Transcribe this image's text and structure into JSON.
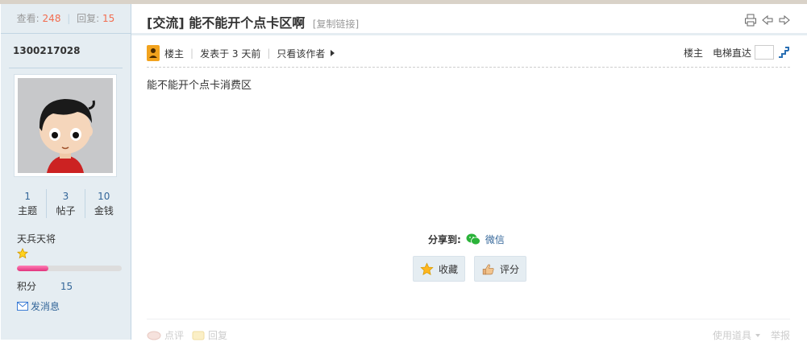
{
  "sidebar": {
    "stats": {
      "views_label": "查看:",
      "views": "248",
      "replies_label": "回复:",
      "replies": "15"
    },
    "username": "1300217028",
    "counts": [
      {
        "value": "1",
        "label": "主题"
      },
      {
        "value": "3",
        "label": "帖子"
      },
      {
        "value": "10",
        "label": "金钱"
      }
    ],
    "rank": "天兵天将",
    "progress": 0.3,
    "points_label": "积分",
    "points_value": "15",
    "message_label": "发消息"
  },
  "post": {
    "tag": "[交流]",
    "title": "能不能开个点卡区啊",
    "copy_link": "[复制链接]",
    "author_role": "楼主",
    "posted": "发表于 3 天前",
    "only_author": "只看该作者",
    "floor": "楼主",
    "elevator": "电梯直达",
    "content": "能不能开个点卡消费区",
    "share_label": "分享到:",
    "share_wechat": "微信",
    "favorite": "收藏",
    "rate": "评分",
    "comment": "点评",
    "reply": "回复",
    "tools": "使用道具",
    "report": "举报"
  },
  "colors": {
    "accent": "#336699",
    "highlight": "#f26c4f",
    "sidebar_bg": "#e5edf2"
  }
}
